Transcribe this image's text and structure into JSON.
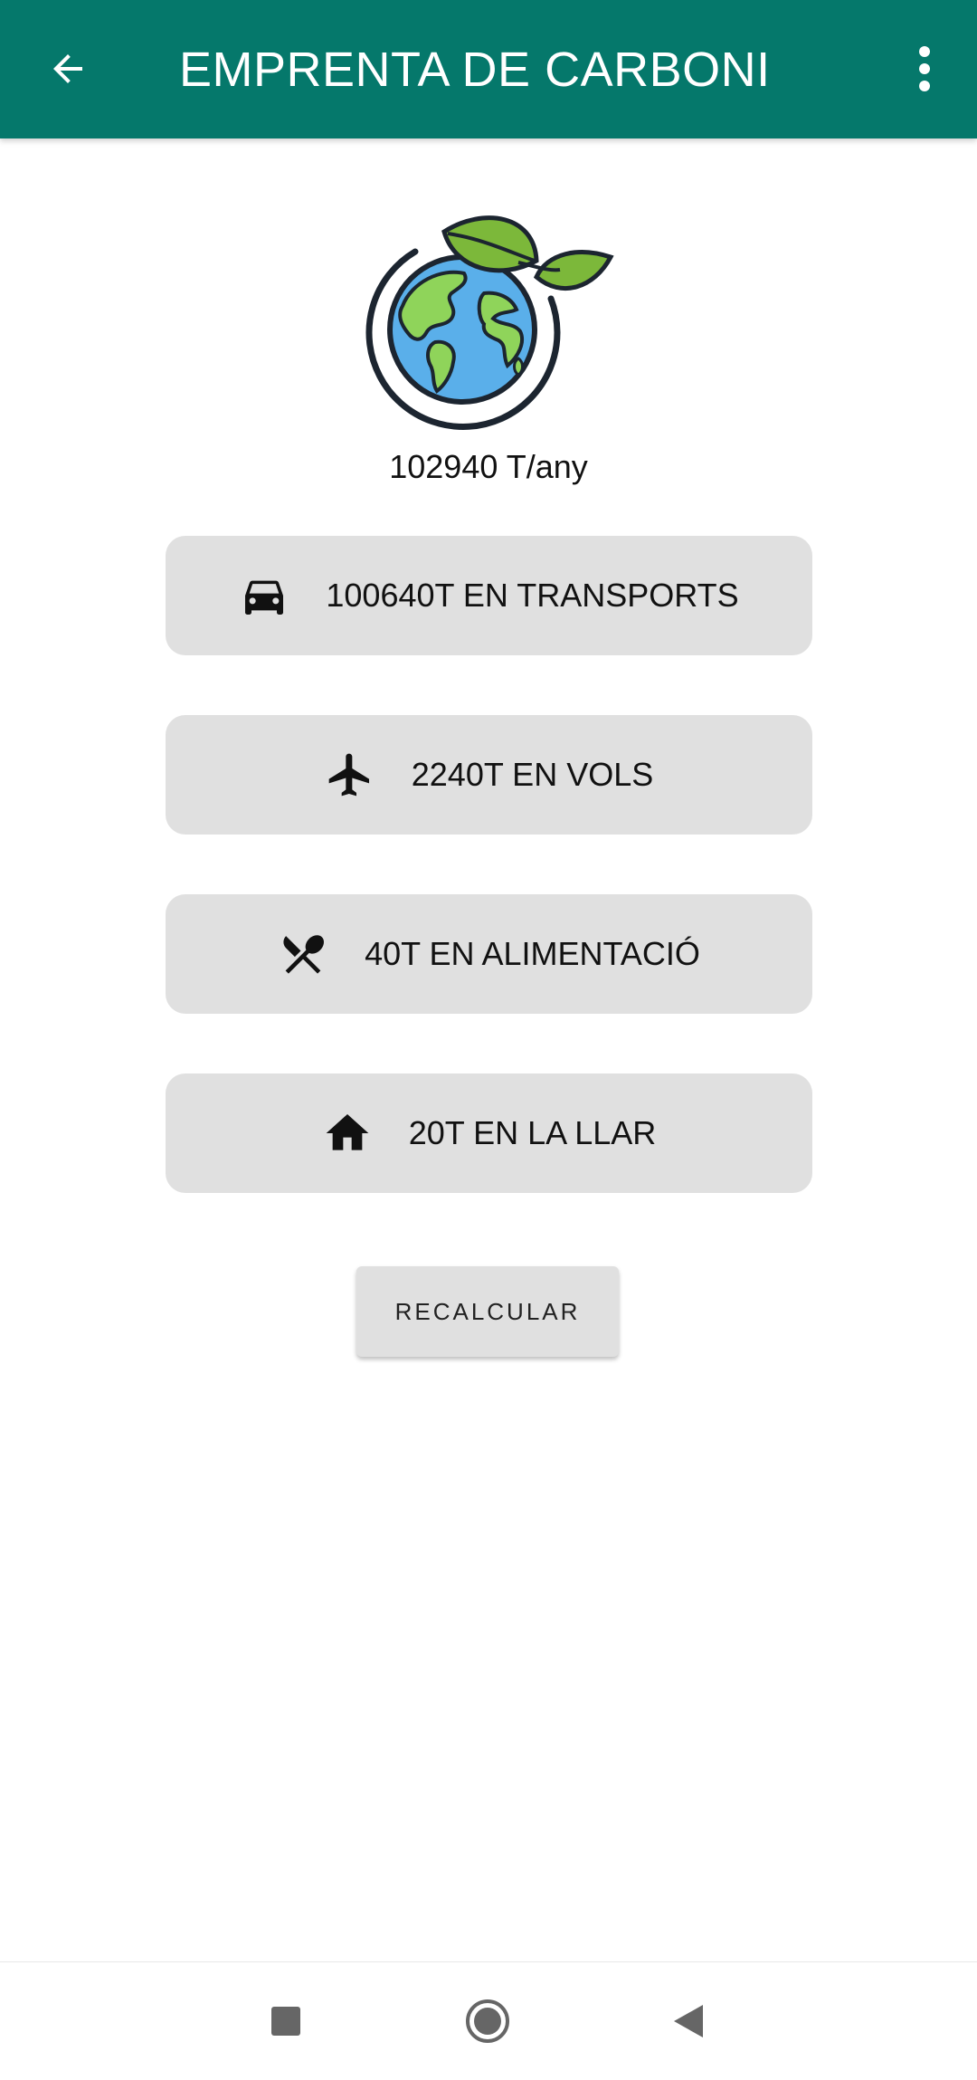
{
  "appbar": {
    "title": "EMPRENTA DE CARBONI",
    "back_icon": "arrow-back-icon",
    "more_icon": "more-vert-icon",
    "color": "#05786b"
  },
  "summary": {
    "total": "102940 T/any"
  },
  "categories": [
    {
      "icon": "car-icon",
      "label": "100640T EN TRANSPORTS"
    },
    {
      "icon": "airplane-icon",
      "label": "2240T EN VOLS"
    },
    {
      "icon": "restaurant-icon",
      "label": "40T EN ALIMENTACIÓ"
    },
    {
      "icon": "home-icon",
      "label": "20T EN LA LLAR"
    }
  ],
  "actions": {
    "recalculate_label": "RECALCULAR"
  },
  "navbar": {
    "recent_icon": "square-icon",
    "home_icon": "circle-icon",
    "back_icon": "triangle-back-icon"
  }
}
